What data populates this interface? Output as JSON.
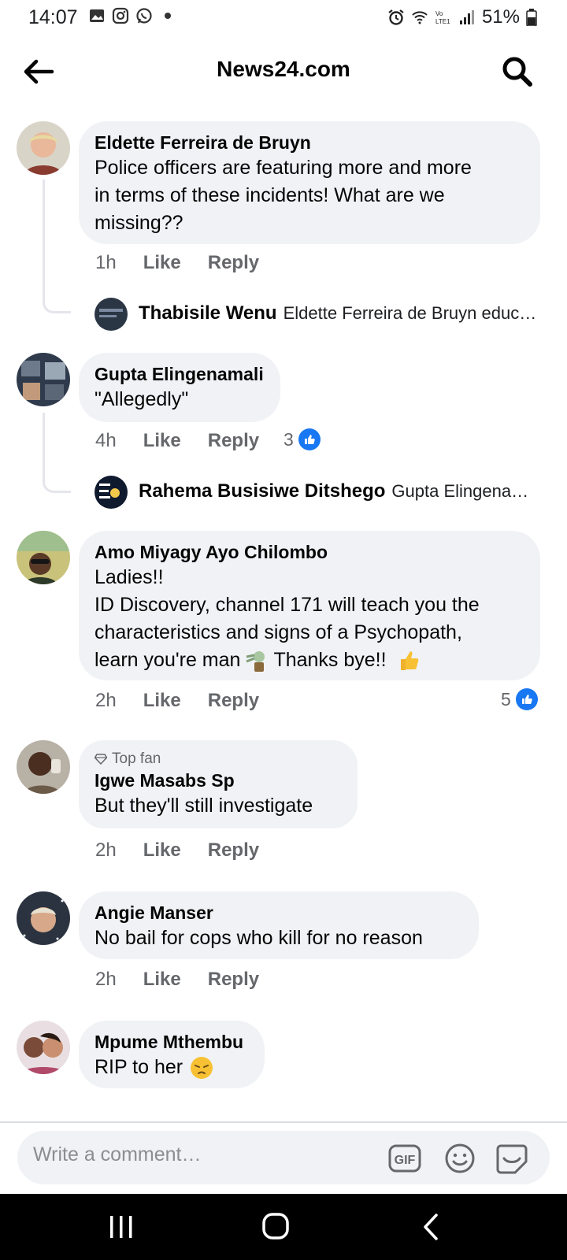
{
  "status_bar": {
    "time": "14:07",
    "battery": "51%",
    "left_icons": [
      "gallery-icon",
      "instagram-icon",
      "whatsapp-icon",
      "dot-icon"
    ],
    "right_icons": [
      "alarm-icon",
      "wifi-icon",
      "volte-icon",
      "signal-icon",
      "battery-icon"
    ]
  },
  "header": {
    "title": "News24.com"
  },
  "comments": [
    {
      "author": "Eldette Ferreira de Bruyn",
      "lines": [
        "Police officers are featuring more and more",
        "in terms of these incidents! What are we",
        "missing??"
      ],
      "time": "1h",
      "like_label": "Like",
      "reply_label": "Reply",
      "reply": {
        "name": "Thabisile Wenu",
        "preview": "Eldette Ferreira de Bruyn educa…"
      }
    },
    {
      "author": "Gupta Elingenamali",
      "lines": [
        "\"Allegedly\""
      ],
      "time": "4h",
      "like_label": "Like",
      "reply_label": "Reply",
      "reaction_count": "3",
      "reply": {
        "name": "Rahema Busisiwe Ditshego",
        "preview": "Gupta Elingenama…"
      }
    },
    {
      "author": "Amo Miyagy Ayo Chilombo",
      "lines": [
        "Ladies!!",
        "ID Discovery, channel  171 will teach you the",
        "characteristics and signs of a Psychopath,",
        "learn you're man",
        "Thanks bye!!"
      ],
      "time": "2h",
      "like_label": "Like",
      "reply_label": "Reply",
      "reaction_count": "5"
    },
    {
      "badge": "Top fan",
      "author": "Igwe Masabs Sp",
      "lines": [
        "But they'll still investigate"
      ],
      "time": "2h",
      "like_label": "Like",
      "reply_label": "Reply"
    },
    {
      "author": "Angie Manser",
      "lines": [
        "No bail for cops who kill for no reason"
      ],
      "time": "2h",
      "like_label": "Like",
      "reply_label": "Reply"
    },
    {
      "author": "Mpume Mthembu",
      "lines": [
        "RIP to her"
      ]
    }
  ],
  "composer": {
    "placeholder": "Write a comment…",
    "gif_label": "GIF"
  },
  "colors": {
    "bubble": "#f0f2f5",
    "like_blue": "#1877f2",
    "muted_text": "#65676b"
  }
}
